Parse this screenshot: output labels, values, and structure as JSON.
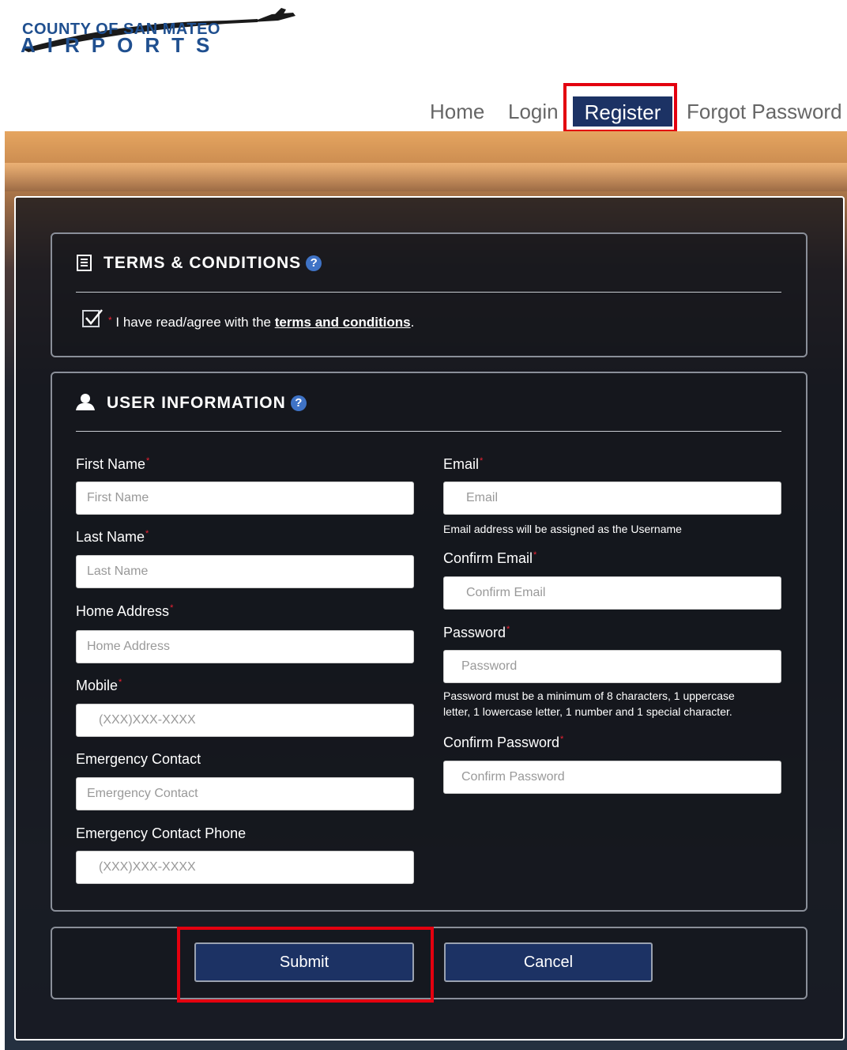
{
  "logo": {
    "line1": "COUNTY OF SAN MATEO",
    "line2": "AIRPORTS"
  },
  "nav": {
    "home": "Home",
    "login": "Login",
    "register": "Register",
    "forgot": "Forgot Password"
  },
  "terms": {
    "title": "TERMS & CONDITIONS",
    "help": "?",
    "agree_text": "I have read/agree with the ",
    "link": "terms and conditions",
    "period": ".",
    "checked": true
  },
  "user": {
    "title": "USER INFORMATION",
    "help": "?",
    "required_mark": "*",
    "first_name": {
      "label": "First Name",
      "placeholder": "First Name"
    },
    "last_name": {
      "label": "Last Name",
      "placeholder": "Last Name"
    },
    "home_address": {
      "label": "Home Address",
      "placeholder": "Home Address"
    },
    "mobile": {
      "label": "Mobile",
      "placeholder": "(XXX)XXX-XXXX"
    },
    "emergency_contact": {
      "label": "Emergency Contact",
      "placeholder": "Emergency Contact"
    },
    "emergency_phone": {
      "label": "Emergency Contact Phone",
      "placeholder": "(XXX)XXX-XXXX"
    },
    "email": {
      "label": "Email",
      "placeholder": "Email",
      "hint": "Email address will be assigned as the Username"
    },
    "confirm_email": {
      "label": "Confirm Email",
      "placeholder": "Confirm Email"
    },
    "password": {
      "label": "Password",
      "placeholder": "Password",
      "hint1": "Password must be a minimum of 8 characters, 1 uppercase",
      "hint2": "letter, 1 lowercase letter, 1 number and 1 special character."
    },
    "confirm_password": {
      "label": "Confirm Password",
      "placeholder": "Confirm Password"
    }
  },
  "actions": {
    "submit": "Submit",
    "cancel": "Cancel"
  },
  "colors": {
    "accent": "#1c3264",
    "highlight": "#e3000f",
    "help": "#3f73c6"
  }
}
